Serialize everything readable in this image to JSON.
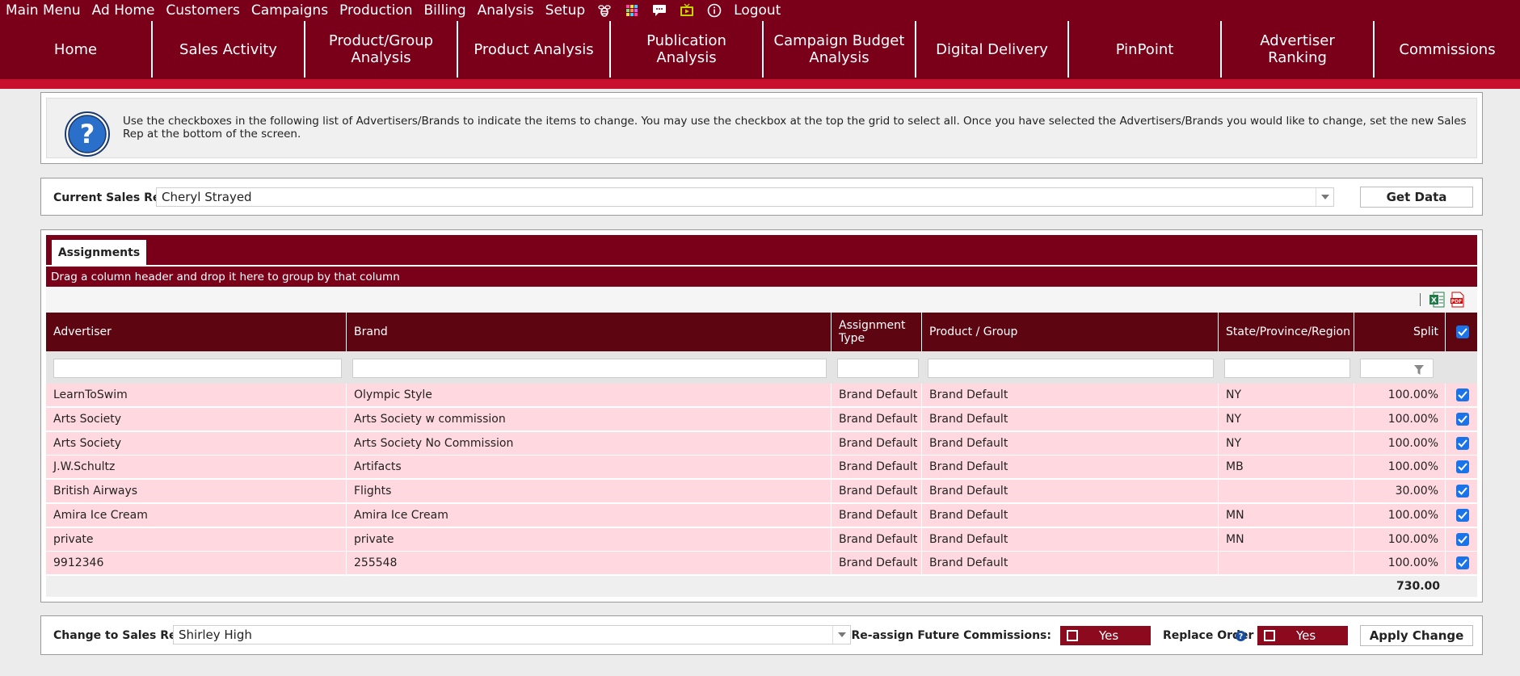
{
  "top_menu": {
    "items": [
      "Main Menu",
      "Ad Home",
      "Customers",
      "Campaigns",
      "Production",
      "Billing",
      "Analysis",
      "Setup"
    ],
    "icons": [
      "bee-icon",
      "apps-grid-icon",
      "chat-icon",
      "tv-icon",
      "info-icon"
    ],
    "logout": "Logout"
  },
  "nav_tabs": [
    "Home",
    "Sales Activity",
    "Product/Group Analysis",
    "Product Analysis",
    "Publication Analysis",
    "Campaign Budget Analysis",
    "Digital Delivery",
    "PinPoint",
    "Advertiser Ranking",
    "Commissions"
  ],
  "info": {
    "text": "Use the checkboxes in the following list of Advertisers/Brands to indicate the items to change. You may use the checkbox at the top the grid to select all. Once you have selected the Advertisers/Brands you would like to change, set the new Sales Rep at the bottom of the screen."
  },
  "sales_rep": {
    "label": "Current Sales Rep",
    "value": "Cheryl Strayed",
    "button": "Get Data"
  },
  "grid": {
    "tab": "Assignments",
    "group_hint": "Drag a column header and drop it here to group by that column",
    "columns": [
      "Advertiser",
      "Brand",
      "Assignment Type",
      "Product / Group",
      "State/Province/Region",
      "Split"
    ],
    "rows": [
      {
        "advertiser": "LearnToSwim",
        "brand": "Olympic Style",
        "type": "Brand Default",
        "product": "Brand Default",
        "state": "NY",
        "split": "100.00%"
      },
      {
        "advertiser": "Arts Society",
        "brand": "Arts Society w commission",
        "type": "Brand Default",
        "product": "Brand Default",
        "state": "NY",
        "split": "100.00%"
      },
      {
        "advertiser": "Arts Society",
        "brand": "Arts Society No Commission",
        "type": "Brand Default",
        "product": "Brand Default",
        "state": "NY",
        "split": "100.00%"
      },
      {
        "advertiser": "J.W.Schultz",
        "brand": "Artifacts",
        "type": "Brand Default",
        "product": "Brand Default",
        "state": "MB",
        "split": "100.00%"
      },
      {
        "advertiser": "British Airways",
        "brand": "Flights",
        "type": "Brand Default",
        "product": "Brand Default",
        "state": "",
        "split": "30.00%"
      },
      {
        "advertiser": "Amira Ice Cream",
        "brand": "Amira Ice Cream",
        "type": "Brand Default",
        "product": "Brand Default",
        "state": "MN",
        "split": "100.00%"
      },
      {
        "advertiser": "private",
        "brand": "private",
        "type": "Brand Default",
        "product": "Brand Default",
        "state": "MN",
        "split": "100.00%"
      },
      {
        "advertiser": "9912346",
        "brand": "255548",
        "type": "Brand Default",
        "product": "Brand Default",
        "state": "",
        "split": "100.00%"
      }
    ],
    "total": "730.00"
  },
  "change": {
    "label": "Change to Sales Rep:",
    "value": "Shirley High",
    "reassign_label": "Re-assign Future Commissions:",
    "reassign_toggle": "Yes",
    "replace_label": "Replace Order Rep(s):",
    "replace_toggle": "Yes",
    "apply": "Apply Change"
  },
  "colors": {
    "brand": "#7a0019",
    "header": "#5e0512",
    "row": "#ffd9df",
    "accent": "#c8102e",
    "checkbox": "#1a73e8"
  }
}
